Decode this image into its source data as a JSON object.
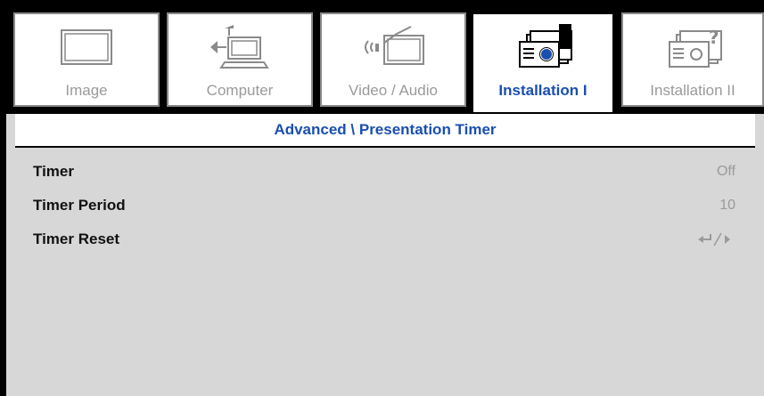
{
  "tabs": [
    {
      "label": "Image",
      "icon": "monitor-icon",
      "active": false
    },
    {
      "label": "Computer",
      "icon": "computer-icon",
      "active": false
    },
    {
      "label": "Video / Audio",
      "icon": "video-audio-icon",
      "active": false
    },
    {
      "label": "Installation I",
      "icon": "projector-icon",
      "active": true
    },
    {
      "label": "Installation II",
      "icon": "projector-question-icon",
      "active": false
    }
  ],
  "panel": {
    "title": "Advanced \\ Presentation Timer",
    "rows": [
      {
        "name": "Timer",
        "value": "Off"
      },
      {
        "name": "Timer Period",
        "value": "10"
      },
      {
        "name": "Timer Reset",
        "value_icon": "enter-right-icon"
      }
    ]
  },
  "colors": {
    "accent": "#1a4fb0",
    "panel_bg": "#d7d7d7",
    "inactive_text": "#9a9a9a"
  }
}
